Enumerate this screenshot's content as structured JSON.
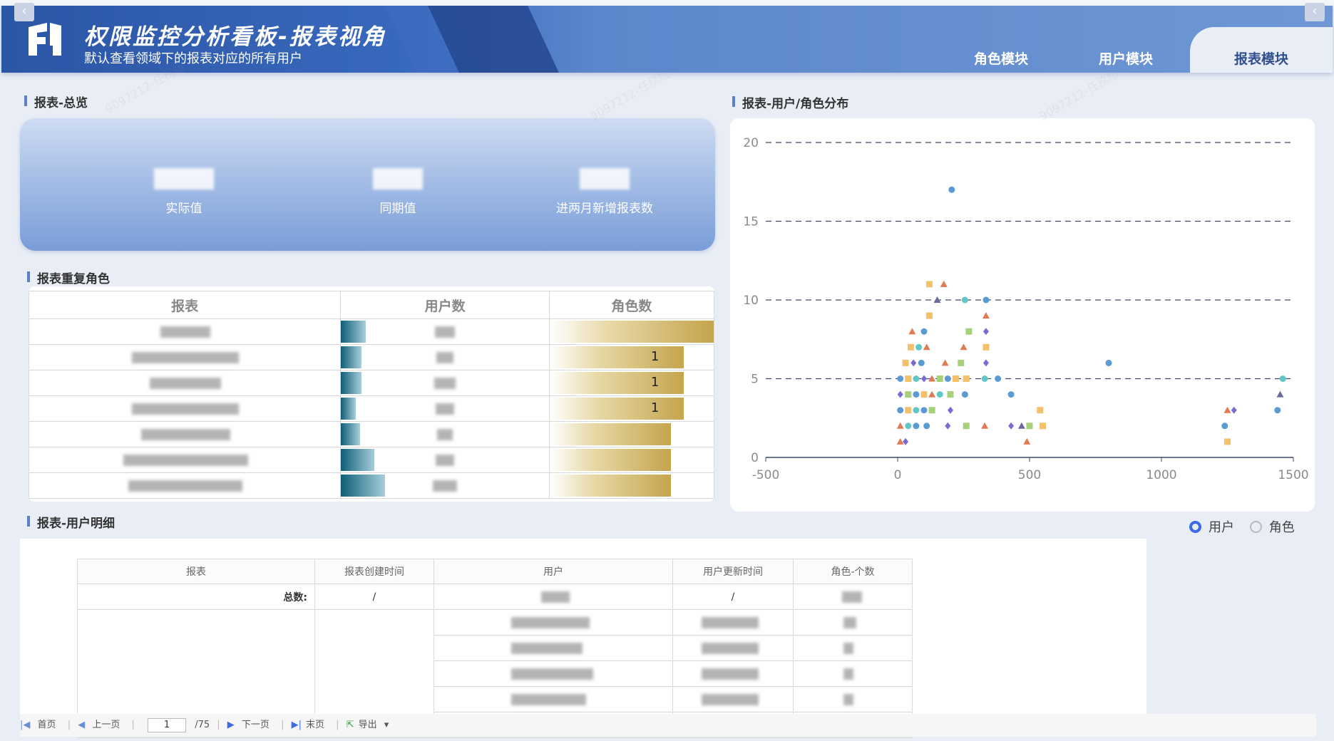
{
  "header": {
    "title": "权限监控分析看板-报表视角",
    "subtitle": "默认查看领域下的报表对应的所有用户",
    "tabs": [
      {
        "label": "角色模块",
        "active": false
      },
      {
        "label": "用户模块",
        "active": false
      },
      {
        "label": "报表模块",
        "active": true
      }
    ],
    "nav_left_icon": "chevron-left-icon",
    "nav_right_icon": "chevron-left-icon"
  },
  "overview": {
    "title": "报表-总览",
    "metrics": [
      {
        "label": "实际值"
      },
      {
        "label": "同期值"
      },
      {
        "label": "进两月新增报表数"
      }
    ]
  },
  "duplicate_roles": {
    "title": "报表重复角色",
    "columns": [
      "报表",
      "用户数",
      "角色数"
    ],
    "rows": [
      {
        "role_count_text": "",
        "user_fill": 0.12,
        "role_fill": 1.0
      },
      {
        "role_count_text": "1",
        "user_fill": 0.1,
        "role_fill": 0.82
      },
      {
        "role_count_text": "1",
        "user_fill": 0.1,
        "role_fill": 0.82
      },
      {
        "role_count_text": "1",
        "user_fill": 0.07,
        "role_fill": 0.82
      },
      {
        "role_count_text": "",
        "user_fill": 0.09,
        "role_fill": 0.74
      },
      {
        "role_count_text": "",
        "user_fill": 0.16,
        "role_fill": 0.74
      },
      {
        "role_count_text": "",
        "user_fill": 0.21,
        "role_fill": 0.74
      }
    ]
  },
  "distribution": {
    "title": "报表-用户/角色分布",
    "toggle": {
      "options": [
        "用户",
        "角色"
      ],
      "selected": "用户"
    }
  },
  "chart_data": {
    "type": "scatter",
    "title": "",
    "xlabel": "",
    "ylabel": "",
    "xlim": [
      -500,
      1500
    ],
    "ylim": [
      0,
      20
    ],
    "x_ticks": [
      "-500",
      "0",
      "500",
      "1000",
      "1500"
    ],
    "y_ticks": [
      "0",
      "5",
      "10",
      "15",
      "20"
    ],
    "grid": "horizontal dashed",
    "colors": [
      "#5b9bd5",
      "#f4c16b",
      "#e07b54",
      "#7b6ad0",
      "#63c6c6",
      "#a7d07b",
      "#6a6a9a"
    ],
    "points": [
      [
        205,
        17,
        0
      ],
      [
        120,
        11,
        1
      ],
      [
        175,
        11,
        2
      ],
      [
        150,
        10,
        6
      ],
      [
        255,
        10,
        4
      ],
      [
        335,
        10,
        0
      ],
      [
        120,
        9,
        1
      ],
      [
        335,
        9,
        2
      ],
      [
        55,
        8,
        2
      ],
      [
        100,
        8,
        0
      ],
      [
        270,
        8,
        5
      ],
      [
        335,
        8,
        3
      ],
      [
        50,
        7,
        1
      ],
      [
        80,
        7,
        4
      ],
      [
        110,
        7,
        2
      ],
      [
        250,
        7,
        2
      ],
      [
        335,
        7,
        1
      ],
      [
        30,
        6,
        1
      ],
      [
        60,
        6,
        3
      ],
      [
        90,
        6,
        0
      ],
      [
        180,
        6,
        2
      ],
      [
        240,
        6,
        5
      ],
      [
        335,
        6,
        3
      ],
      [
        800,
        6,
        0
      ],
      [
        10,
        5,
        0
      ],
      [
        40,
        5,
        1
      ],
      [
        70,
        5,
        4
      ],
      [
        100,
        5,
        3
      ],
      [
        130,
        5,
        2
      ],
      [
        160,
        5,
        5
      ],
      [
        190,
        5,
        0
      ],
      [
        220,
        5,
        1
      ],
      [
        260,
        5,
        1
      ],
      [
        330,
        5,
        4
      ],
      [
        380,
        5,
        0
      ],
      [
        1460,
        5,
        4
      ],
      [
        10,
        4,
        3
      ],
      [
        40,
        4,
        5
      ],
      [
        70,
        4,
        0
      ],
      [
        100,
        4,
        1
      ],
      [
        130,
        4,
        2
      ],
      [
        160,
        4,
        4
      ],
      [
        200,
        4,
        5
      ],
      [
        255,
        4,
        0
      ],
      [
        430,
        4,
        0
      ],
      [
        1450,
        4,
        6
      ],
      [
        10,
        3,
        0
      ],
      [
        40,
        3,
        1
      ],
      [
        70,
        3,
        4
      ],
      [
        100,
        3,
        0
      ],
      [
        130,
        3,
        5
      ],
      [
        200,
        3,
        3
      ],
      [
        540,
        3,
        1
      ],
      [
        1250,
        3,
        2
      ],
      [
        1275,
        3,
        3
      ],
      [
        1440,
        3,
        0
      ],
      [
        10,
        2,
        2
      ],
      [
        40,
        2,
        4
      ],
      [
        70,
        2,
        0
      ],
      [
        110,
        2,
        0
      ],
      [
        190,
        2,
        3
      ],
      [
        260,
        2,
        5
      ],
      [
        330,
        2,
        2
      ],
      [
        430,
        2,
        3
      ],
      [
        470,
        2,
        6
      ],
      [
        500,
        2,
        5
      ],
      [
        550,
        2,
        1
      ],
      [
        1240,
        2,
        0
      ],
      [
        10,
        1,
        2
      ],
      [
        30,
        1,
        3
      ],
      [
        490,
        1,
        2
      ],
      [
        1250,
        1,
        1
      ]
    ]
  },
  "detail": {
    "title": "报表-用户明细",
    "columns": [
      "报表",
      "报表创建时间",
      "用户",
      "用户更新时间",
      "角色-个数"
    ],
    "total_label": "总数:",
    "total_create_time": "/",
    "total_update_time": "/"
  },
  "pager": {
    "first": "首页",
    "prev": "上一页",
    "current": "1",
    "total": "/75",
    "next": "下一页",
    "last": "末页",
    "export": "导出"
  }
}
